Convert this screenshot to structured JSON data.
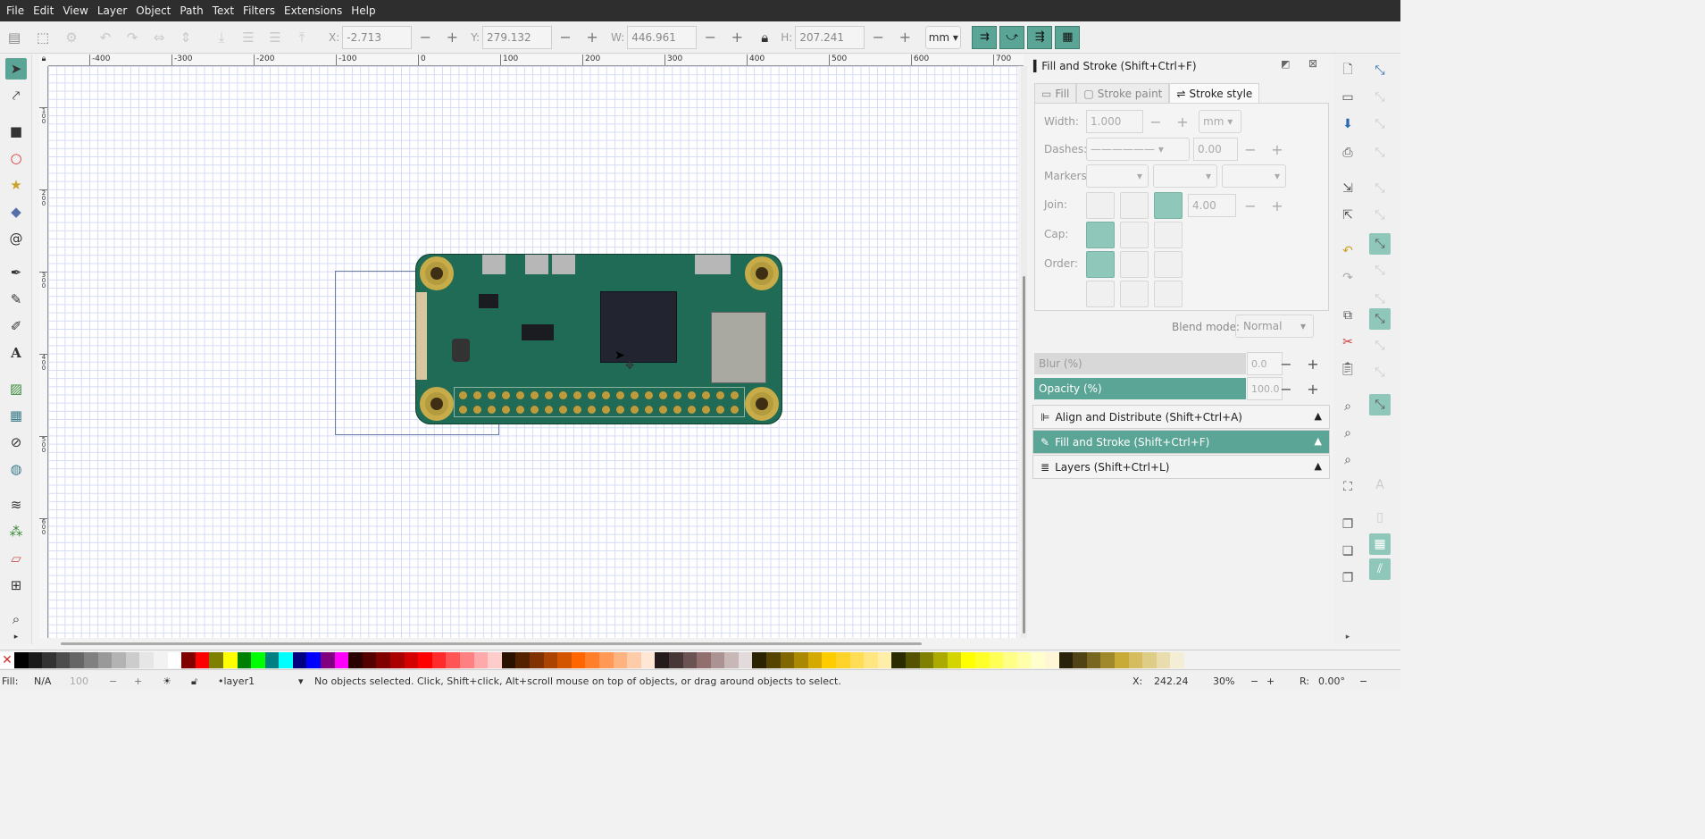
{
  "menu": [
    "File",
    "Edit",
    "View",
    "Layer",
    "Object",
    "Path",
    "Text",
    "Filters",
    "Extensions",
    "Help"
  ],
  "toolbar": {
    "x_label": "X:",
    "x_value": "-2.713",
    "y_label": "Y:",
    "y_value": "279.132",
    "w_label": "W:",
    "w_value": "446.961",
    "h_label": "H:",
    "h_value": "207.241",
    "unit": "mm",
    "minus": "−",
    "plus": "+"
  },
  "ruler": {
    "top_ticks": [
      "-400",
      "-300",
      "-200",
      "-100",
      "0",
      "100",
      "200",
      "300",
      "400",
      "500",
      "600",
      "700"
    ],
    "left_ticks": [
      "1 0 0",
      "2 0 0",
      "3 0 0",
      "4 0 0",
      "5 0 0",
      "6 0 0"
    ]
  },
  "panel": {
    "title": "Fill and Stroke (Shift+Ctrl+F)",
    "tabs": [
      "Fill",
      "Stroke paint",
      "Stroke style"
    ],
    "width_label": "Width:",
    "width_value": "1.000",
    "width_unit": "mm",
    "dashes_label": "Dashes:",
    "dashes_value": "0.00",
    "markers_label": "Markers:",
    "join_label": "Join:",
    "join_value": "4.00",
    "cap_label": "Cap:",
    "order_label": "Order:",
    "blend_label": "Blend mode:",
    "blend_value": "Normal",
    "blur_label": "Blur (%)",
    "blur_value": "0.0",
    "opacity_label": "Opacity (%)",
    "opacity_value": "100.0",
    "sections": [
      "Align and Distribute (Shift+Ctrl+A)",
      "Fill and Stroke (Shift+Ctrl+F)",
      "Layers (Shift+Ctrl+L)"
    ]
  },
  "status": {
    "fill_label": "Fill:",
    "fill_value": "N/A",
    "stroke_value": "100",
    "layer": "•layer1",
    "message": "No objects selected. Click, Shift+click, Alt+scroll mouse on top of objects, or drag around objects to select.",
    "x_label": "X:",
    "x_value": "242.24",
    "zoom_value": "30%",
    "rotation_label": "R:",
    "rotation_value": "0.00°"
  },
  "colors": {
    "accent": "#5ba596",
    "menubar": "#2e2e2e",
    "grid": "#d6dbf5",
    "pcb": "#1f6b55"
  }
}
